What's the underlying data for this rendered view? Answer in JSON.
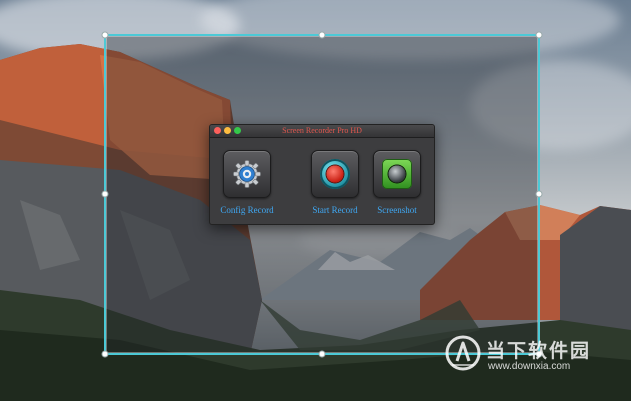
{
  "window": {
    "title": "Screen Recorder Pro HD"
  },
  "tools": [
    {
      "label": "Config Record",
      "icon": "gear-icon"
    },
    {
      "label": "Start Record",
      "icon": "record-icon"
    },
    {
      "label": "Screenshot",
      "icon": "camera-icon"
    }
  ],
  "watermark": {
    "brand": "当下软件园",
    "url": "www.downxia.com"
  },
  "colors": {
    "selection_border": "#4cc9d6",
    "window_title": "#e2574e",
    "tool_label": "#3fa9f5"
  }
}
